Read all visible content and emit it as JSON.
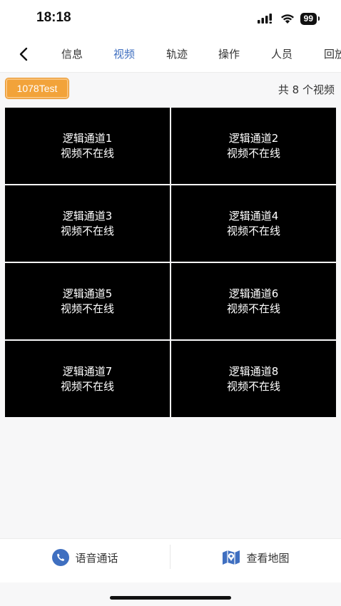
{
  "status": {
    "time": "18:18",
    "battery": "99",
    "icons": [
      "signal-icon",
      "wifi-icon",
      "battery-icon"
    ]
  },
  "nav": {
    "back_icon": "chevron-left-icon",
    "tabs": [
      {
        "label": "信息",
        "active": false
      },
      {
        "label": "视频",
        "active": true
      },
      {
        "label": "轨迹",
        "active": false
      },
      {
        "label": "操作",
        "active": false
      },
      {
        "label": "人员",
        "active": false
      },
      {
        "label": "回放",
        "active": false
      }
    ],
    "active_color": "#3f6fc0"
  },
  "device": {
    "name": "1078Test",
    "video_count": "共 8 个视频",
    "badge_color": "#f2a33a"
  },
  "channels": [
    {
      "name": "逻辑通道1",
      "status": "视频不在线"
    },
    {
      "name": "逻辑通道2",
      "status": "视频不在线"
    },
    {
      "name": "逻辑通道3",
      "status": "视频不在线"
    },
    {
      "name": "逻辑通道4",
      "status": "视频不在线"
    },
    {
      "name": "逻辑通道5",
      "status": "视频不在线"
    },
    {
      "name": "逻辑通道6",
      "status": "视频不在线"
    },
    {
      "name": "逻辑通道7",
      "status": "视频不在线"
    },
    {
      "name": "逻辑通道8",
      "status": "视频不在线"
    }
  ],
  "actions": {
    "voice_call": {
      "label": "语音通话",
      "icon": "phone-icon",
      "color": "#3f6fc0"
    },
    "view_map": {
      "label": "查看地图",
      "icon": "map-icon",
      "color": "#3f6fc0"
    }
  }
}
